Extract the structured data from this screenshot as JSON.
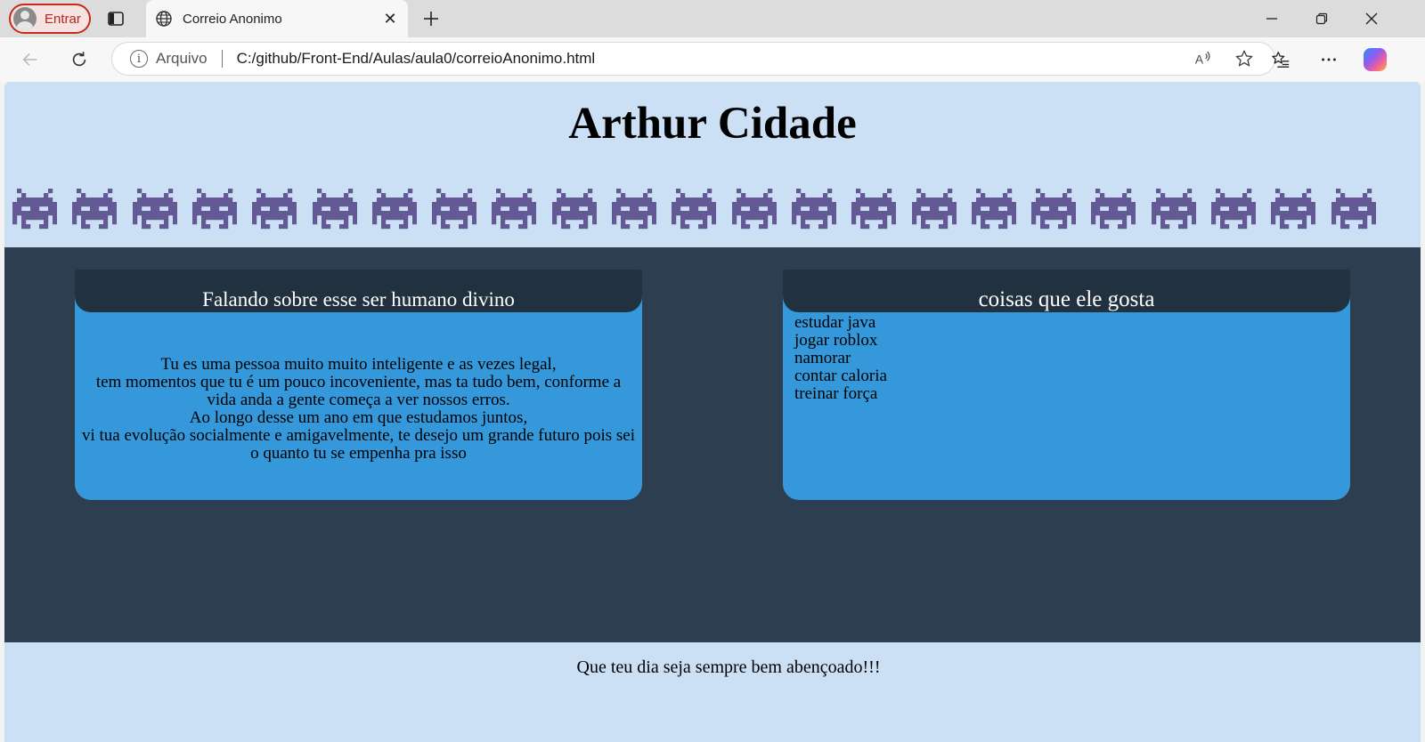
{
  "browser": {
    "profile_label": "Entrar",
    "tab_title": "Correio Anonimo",
    "security_label": "Arquivo",
    "url": "C:/github/Front-End/Aulas/aula0/correioAnonimo.html",
    "icons": [
      "profile-icon",
      "tab-actions-icon",
      "globe-icon",
      "close-icon",
      "plus-icon",
      "minimize-icon",
      "restore-icon",
      "window-close-icon",
      "back-icon",
      "refresh-icon",
      "info-icon",
      "read-aloud-icon",
      "star-icon",
      "favorites-icon",
      "more-icon",
      "copilot-icon"
    ]
  },
  "page": {
    "title": "Arthur Cidade",
    "invader_icon": "space-invader-icon",
    "invader_count": 23,
    "invader_color": "#635994",
    "colors": {
      "header_bg": "#cce0f5",
      "main_bg": "#2d3e50",
      "card_bg": "#3498db",
      "card_header_bg": "#223140"
    },
    "about_card": {
      "heading": "Falando sobre esse ser humano divino",
      "lines": [
        "Tu es uma pessoa muito muito inteligente e as vezes legal,",
        "tem momentos que tu é um pouco incoveniente, mas ta tudo bem, conforme a vida anda a gente começa a ver nossos erros.",
        "Ao longo desse um ano em que estudamos juntos,",
        "vi tua evolução socialmente e amigavelmente, te desejo um grande futuro pois sei o quanto tu se empenha pra isso"
      ]
    },
    "likes_card": {
      "heading": "coisas que ele gosta",
      "items": [
        "estudar java",
        "jogar roblox",
        "namorar",
        "contar caloria",
        "treinar força"
      ]
    },
    "footer_text": "Que teu dia seja sempre bem abençoado!!!"
  }
}
